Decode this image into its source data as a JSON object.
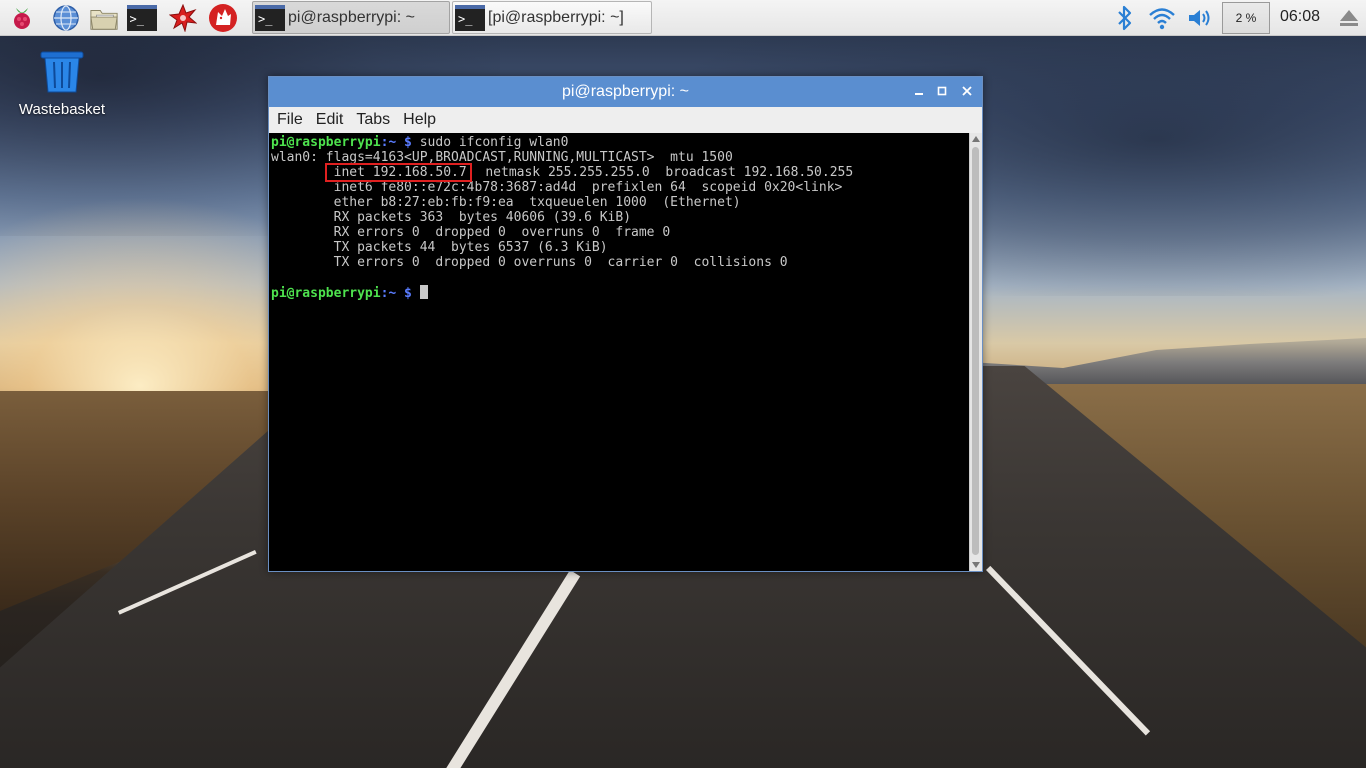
{
  "taskbar": {
    "launchers": [
      {
        "icon": "raspberry-menu-icon"
      },
      {
        "icon": "web-browser-icon"
      },
      {
        "icon": "file-manager-icon"
      },
      {
        "icon": "terminal-icon"
      },
      {
        "icon": "mathematica-icon"
      },
      {
        "icon": "wolfram-icon"
      }
    ],
    "tasks": [
      {
        "title": "pi@raspberrypi: ~",
        "active": true
      },
      {
        "title": "[pi@raspberrypi: ~]",
        "active": false
      }
    ],
    "tray": {
      "cpu_label": "2 %",
      "clock": "06:08"
    }
  },
  "desktop": {
    "icons": [
      {
        "label": "Wastebasket",
        "icon": "wastebasket-icon"
      }
    ]
  },
  "window": {
    "title": "pi@raspberrypi: ~",
    "menu": [
      "File",
      "Edit",
      "Tabs",
      "Help"
    ],
    "terminal": {
      "prompt_user": "pi@raspberrypi",
      "prompt_path": ":~ $",
      "command": " sudo ifconfig wlan0",
      "output": [
        "wlan0: flags=4163<UP,BROADCAST,RUNNING,MULTICAST>  mtu 1500",
        "inet 192.168.50.7",
        "  netmask 255.255.255.0  broadcast 192.168.50.255",
        "        inet6 fe80::e72c:4b78:3687:ad4d  prefixlen 64  scopeid 0x20<link>",
        "        ether b8:27:eb:fb:f9:ea  txqueuelen 1000  (Ethernet)",
        "        RX packets 363  bytes 40606 (39.6 KiB)",
        "        RX errors 0  dropped 0  overruns 0  frame 0",
        "        TX packets 44  bytes 6537 (6.3 KiB)",
        "        TX errors 0  dropped 0 overruns 0  carrier 0  collisions 0"
      ]
    }
  },
  "colors": {
    "titlebar": "#5a8ed0",
    "prompt_user": "#4ee24e",
    "prompt_path": "#5a7cff",
    "highlight_box": "#e02020"
  }
}
